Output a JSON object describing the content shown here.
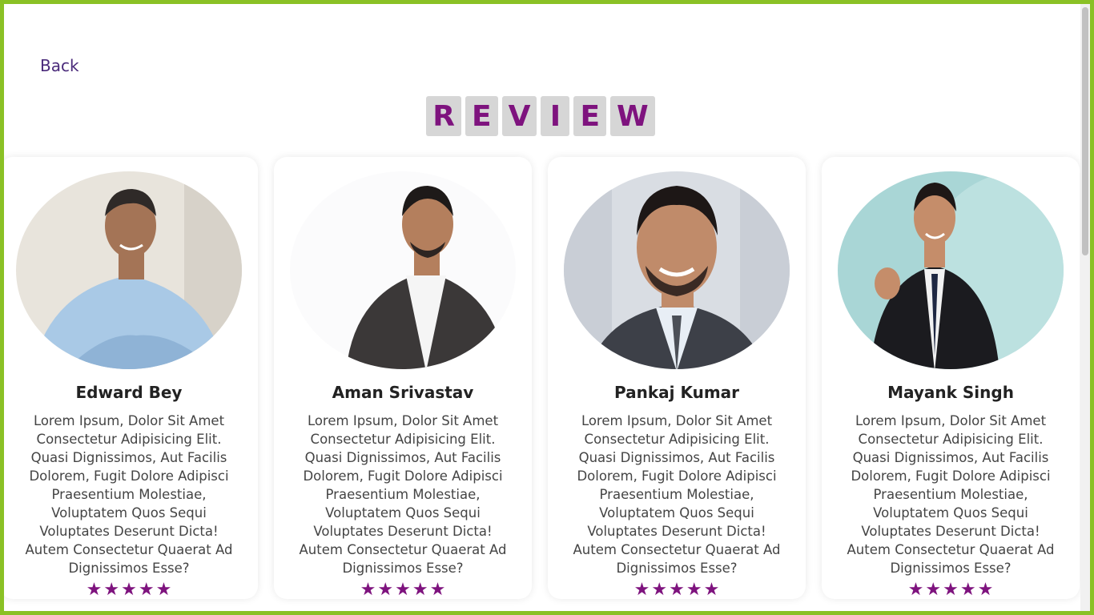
{
  "nav": {
    "back_label": "Back"
  },
  "heading": {
    "letters": [
      "R",
      "E",
      "V",
      "I",
      "E",
      "W"
    ]
  },
  "colors": {
    "accent": "#7e137e",
    "border": "#8ac125",
    "tile": "#d6d6d6"
  },
  "reviews": [
    {
      "name": "Edward Bey",
      "text": "Lorem Ipsum, Dolor Sit Amet Consectetur Adipisicing Elit. Quasi Dignissimos, Aut Facilis Dolorem, Fugit Dolore Adipisci Praesentium Molestiae, Voluptatem Quos Sequi Voluptates Deserunt Dicta! Autem Consectetur Quaerat Ad Dignissimos Esse?",
      "rating": 5
    },
    {
      "name": "Aman Srivastav",
      "text": "Lorem Ipsum, Dolor Sit Amet Consectetur Adipisicing Elit. Quasi Dignissimos, Aut Facilis Dolorem, Fugit Dolore Adipisci Praesentium Molestiae, Voluptatem Quos Sequi Voluptates Deserunt Dicta! Autem Consectetur Quaerat Ad Dignissimos Esse?",
      "rating": 5
    },
    {
      "name": "Pankaj Kumar",
      "text": "Lorem Ipsum, Dolor Sit Amet Consectetur Adipisicing Elit. Quasi Dignissimos, Aut Facilis Dolorem, Fugit Dolore Adipisci Praesentium Molestiae, Voluptatem Quos Sequi Voluptates Deserunt Dicta! Autem Consectetur Quaerat Ad Dignissimos Esse?",
      "rating": 5
    },
    {
      "name": "Mayank Singh",
      "text": "Lorem Ipsum, Dolor Sit Amet Consectetur Adipisicing Elit. Quasi Dignissimos, Aut Facilis Dolorem, Fugit Dolore Adipisci Praesentium Molestiae, Voluptatem Quos Sequi Voluptates Deserunt Dicta! Autem Consectetur Quaerat Ad Dignissimos Esse?",
      "rating": 5
    }
  ]
}
